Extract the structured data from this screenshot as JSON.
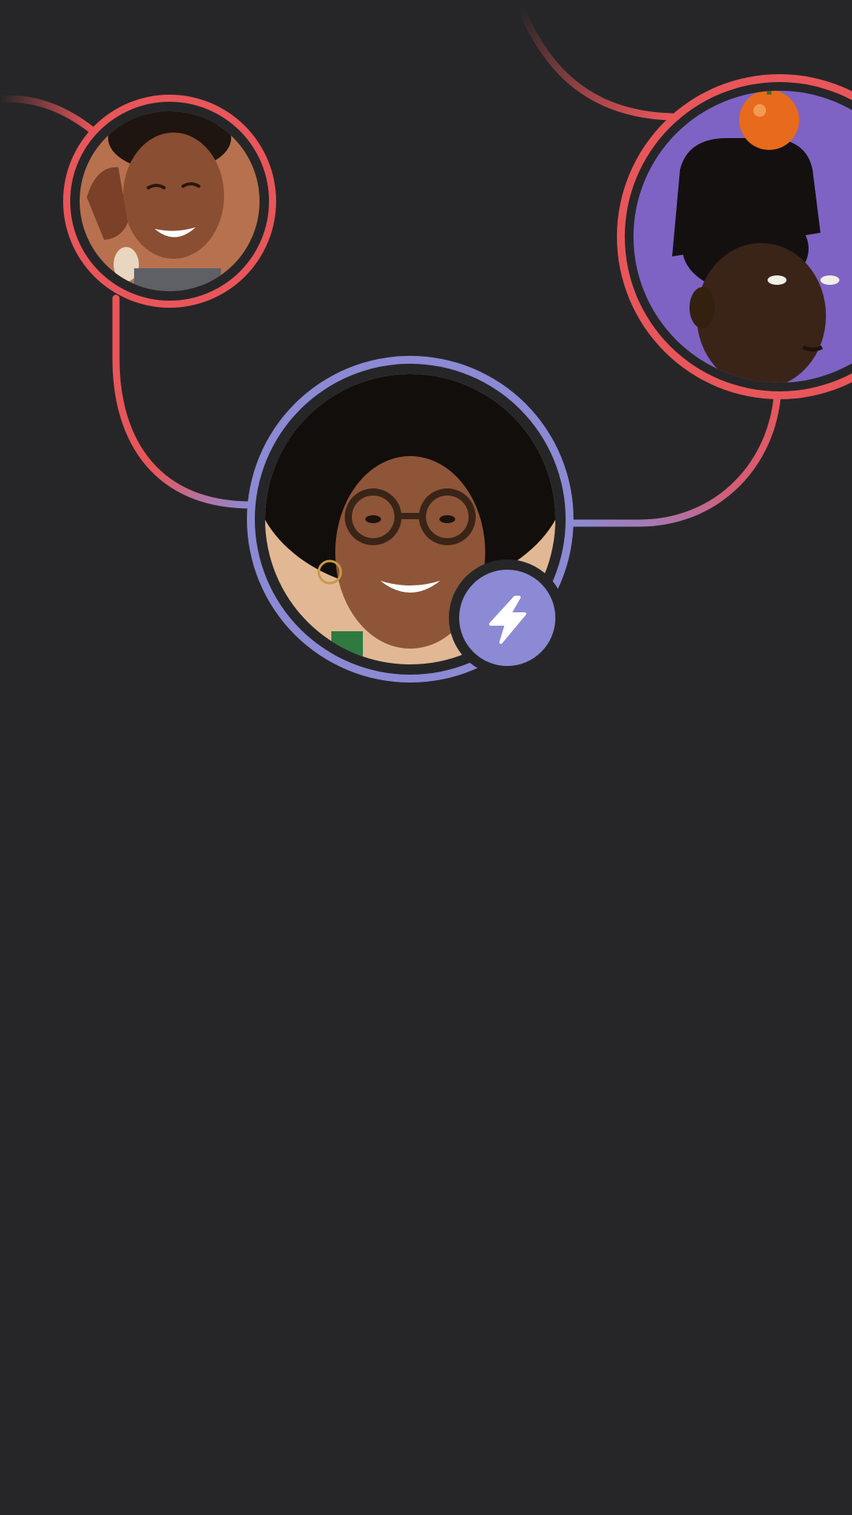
{
  "colors": {
    "background": "#262628",
    "ring_red": "#E8565A",
    "ring_purple": "#8C8AD4",
    "gap_dark": "#262628",
    "badge_fill": "#8C8AD4",
    "badge_icon": "#FFFFFF"
  },
  "avatars": [
    {
      "id": "avatar-left",
      "description_icon": "person-avatar",
      "ring": "red",
      "bg": "#B8714E",
      "skin": "#8A4E32",
      "hair": "#1E1410"
    },
    {
      "id": "avatar-right",
      "description_icon": "person-avatar",
      "ring": "red",
      "bg": "#7E63C4",
      "skin": "#3A2418",
      "hair": "#141010",
      "accent": "#E86A1C"
    },
    {
      "id": "avatar-center",
      "description_icon": "person-avatar",
      "ring": "purple",
      "bg": "#E2B894",
      "skin": "#8E5538",
      "hair": "#120E0C",
      "accent": "#3A2418",
      "badge": {
        "icon": "lightning-bolt-icon"
      }
    }
  ]
}
